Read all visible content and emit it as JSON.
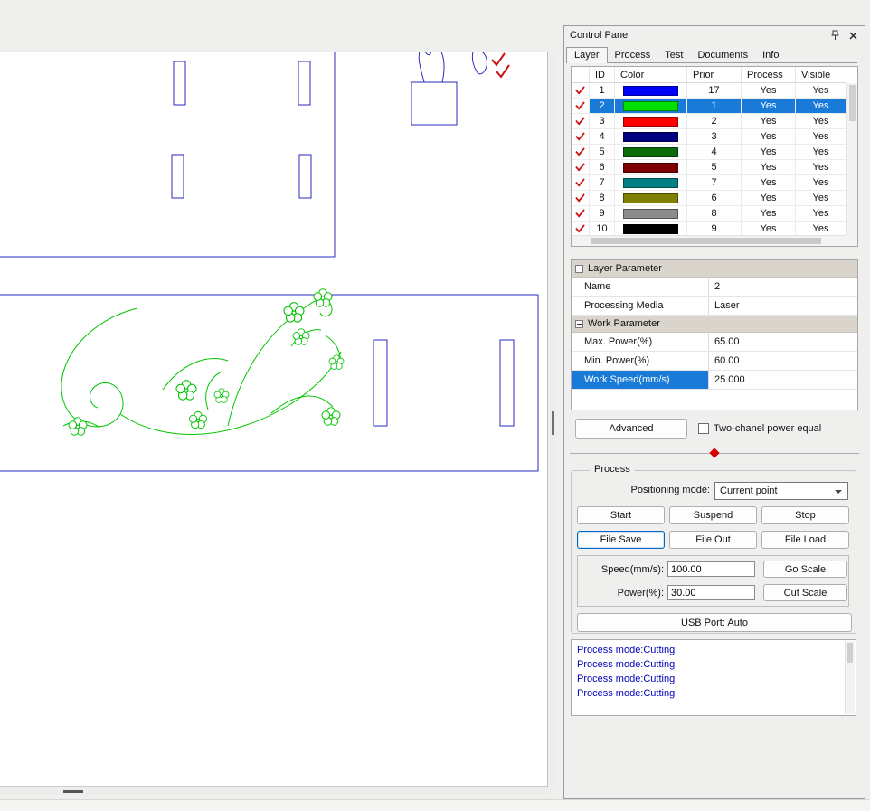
{
  "colors": {
    "selection": "#1a7ad8",
    "outline_blue": "#2a2ac0",
    "floral_green": "#00c400",
    "check_red": "#cc1111",
    "log_text": "#0000bb"
  },
  "control_panel": {
    "title": "Control Panel",
    "tabs": [
      {
        "label": "Layer",
        "active": true
      },
      {
        "label": "Process",
        "active": false
      },
      {
        "label": "Test",
        "active": false
      },
      {
        "label": "Documents",
        "active": false
      },
      {
        "label": "Info",
        "active": false
      }
    ],
    "layer_table": {
      "columns": [
        "ID",
        "Color",
        "Prior",
        "Process",
        "Visible"
      ],
      "rows": [
        {
          "id": "1",
          "color": "#0000ff",
          "prior": "17",
          "process": "Yes",
          "visible": "Yes",
          "selected": false
        },
        {
          "id": "2",
          "color": "#00e000",
          "prior": "1",
          "process": "Yes",
          "visible": "Yes",
          "selected": true
        },
        {
          "id": "3",
          "color": "#ff0000",
          "prior": "2",
          "process": "Yes",
          "visible": "Yes",
          "selected": false
        },
        {
          "id": "4",
          "color": "#000080",
          "prior": "3",
          "process": "Yes",
          "visible": "Yes",
          "selected": false
        },
        {
          "id": "5",
          "color": "#0a6a0a",
          "prior": "4",
          "process": "Yes",
          "visible": "Yes",
          "selected": false
        },
        {
          "id": "6",
          "color": "#800000",
          "prior": "5",
          "process": "Yes",
          "visible": "Yes",
          "selected": false
        },
        {
          "id": "7",
          "color": "#008080",
          "prior": "7",
          "process": "Yes",
          "visible": "Yes",
          "selected": false
        },
        {
          "id": "8",
          "color": "#808000",
          "prior": "6",
          "process": "Yes",
          "visible": "Yes",
          "selected": false
        },
        {
          "id": "9",
          "color": "#8c8c8c",
          "prior": "8",
          "process": "Yes",
          "visible": "Yes",
          "selected": false
        },
        {
          "id": "10",
          "color": "#000000",
          "prior": "9",
          "process": "Yes",
          "visible": "Yes",
          "selected": false
        }
      ]
    },
    "param_grid": [
      {
        "type": "section",
        "label": "Layer Parameter"
      },
      {
        "type": "row",
        "label": "Name",
        "value": "2",
        "selected": false
      },
      {
        "type": "row",
        "label": "Processing Media",
        "value": "Laser",
        "selected": false
      },
      {
        "type": "section",
        "label": "Work Parameter"
      },
      {
        "type": "row",
        "label": "Max. Power(%)",
        "value": "65.00",
        "selected": false
      },
      {
        "type": "row",
        "label": "Min. Power(%)",
        "value": "60.00",
        "selected": false
      },
      {
        "type": "row",
        "label": "Work Speed(mm/s)",
        "value": "25.000",
        "selected": true
      }
    ],
    "advanced_button": "Advanced",
    "two_chanel_checkbox": {
      "label": "Two-chanel power equal",
      "checked": false
    },
    "process": {
      "group_label": "Process",
      "positioning_label": "Positioning mode:",
      "positioning_value": "Current point",
      "buttons_row1": [
        {
          "label": "Start",
          "focused": false
        },
        {
          "label": "Suspend",
          "focused": false
        },
        {
          "label": "Stop",
          "focused": false
        }
      ],
      "buttons_row2": [
        {
          "label": "File Save",
          "focused": true
        },
        {
          "label": "File Out",
          "focused": false
        },
        {
          "label": "File Load",
          "focused": false
        }
      ],
      "speed_label": "Speed(mm/s):",
      "speed_value": "100.00",
      "go_scale_button": "Go Scale",
      "power_label": "Power(%):",
      "power_value": "30.00",
      "cut_scale_button": "Cut Scale",
      "usb_button": "USB Port: Auto"
    },
    "log_lines": [
      "Process mode:Cutting",
      "Process mode:Cutting",
      "Process mode:Cutting",
      "Process mode:Cutting"
    ]
  }
}
